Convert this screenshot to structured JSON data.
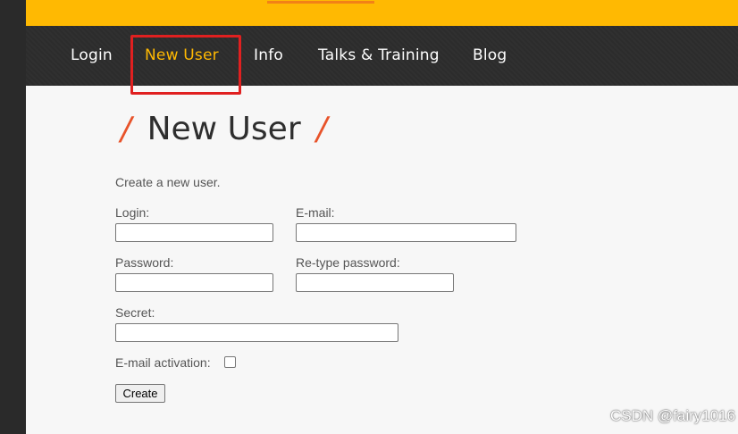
{
  "nav": {
    "items": [
      {
        "label": "Login"
      },
      {
        "label": "New User"
      },
      {
        "label": "Info"
      },
      {
        "label": "Talks & Training"
      },
      {
        "label": "Blog"
      }
    ],
    "active_color": "#ffb902"
  },
  "page": {
    "title": "New User",
    "title_slash_left": "/",
    "title_slash_right": "/",
    "intro": "Create a new user."
  },
  "form": {
    "login_label": "Login:",
    "login_value": "",
    "email_label": "E-mail:",
    "email_value": "",
    "password_label": "Password:",
    "password_value": "",
    "retype_label": "Re-type password:",
    "retype_value": "",
    "secret_label": "Secret:",
    "secret_value": "",
    "activation_label": "E-mail activation:",
    "activation_checked": false,
    "create_label": "Create"
  },
  "watermark": "CSDN @fairy1016",
  "colors": {
    "banner": "#ffb902",
    "nav_bg": "#2c2c2c",
    "accent": "#e8532a",
    "highlight": "#e02020"
  }
}
